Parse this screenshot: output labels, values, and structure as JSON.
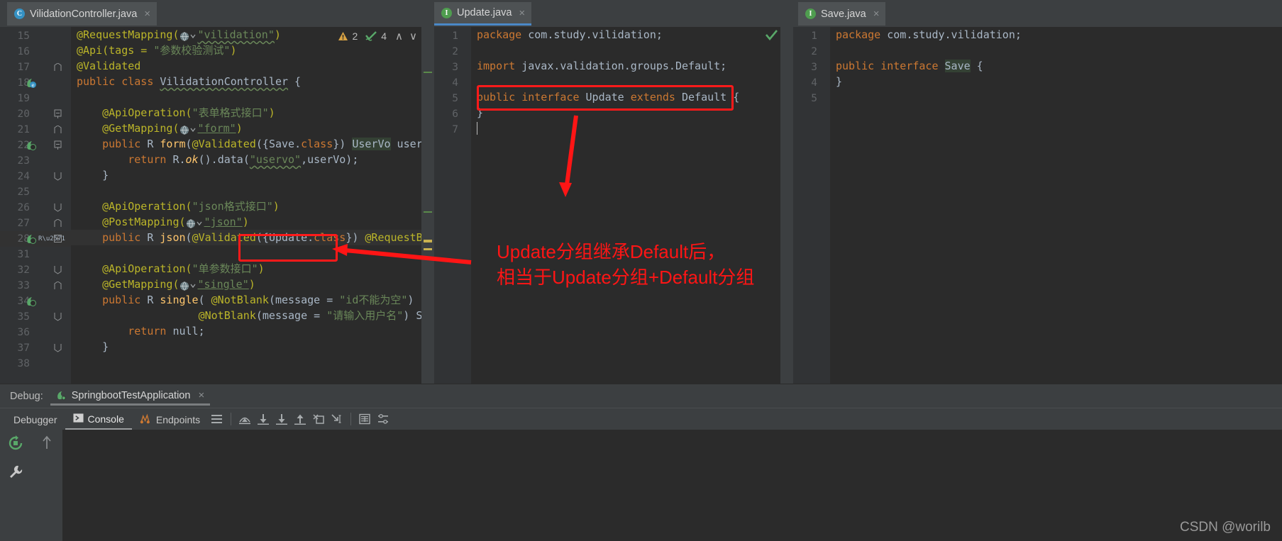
{
  "editors": [
    {
      "tab": {
        "label": "VilidationController.java",
        "icon": "class-icon",
        "close": "×",
        "icon_letter": "C"
      },
      "status": {
        "warnings_icon": "warning-triangle-icon",
        "warnings": "2",
        "checks_icon": "green-check-wave-icon",
        "checks": "4",
        "up": "∧",
        "down": "∨"
      },
      "lines": [
        {
          "n": "15",
          "text": "@RequestMapping(●⌄\"vilidation\")"
        },
        {
          "n": "16",
          "text": "@Api(tags = \"参数校验测试\")"
        },
        {
          "n": "17",
          "text": "@Validated"
        },
        {
          "n": "18",
          "text": "public class VilidationController {"
        },
        {
          "n": "19",
          "text": ""
        },
        {
          "n": "20",
          "text": "    @ApiOperation(\"表单格式接口\")"
        },
        {
          "n": "21",
          "text": "    @GetMapping(●⌄\"form\")"
        },
        {
          "n": "22",
          "text": "    public R form(@Validated({Save.class}) UserVo userVo){"
        },
        {
          "n": "23",
          "text": "        return R.ok().data(\"uservo\",userVo);"
        },
        {
          "n": "24",
          "text": "    }"
        },
        {
          "n": "25",
          "text": ""
        },
        {
          "n": "26",
          "text": "    @ApiOperation(\"json格式接口\")"
        },
        {
          "n": "27",
          "text": "    @PostMapping(●⌄\"json\")"
        },
        {
          "n": "28",
          "text": "    public R json(@Validated({Update.class}) @RequestBody Use"
        },
        {
          "n": "31",
          "text": ""
        },
        {
          "n": "32",
          "text": "    @ApiOperation(\"单参数接口\")"
        },
        {
          "n": "33",
          "text": "    @GetMapping(●⌄\"single\")"
        },
        {
          "n": "34",
          "text": "    public R single( @NotBlank(message = \"id不能为空\")  String"
        },
        {
          "n": "35",
          "text": "                   @NotBlank(message = \"请输入用户名\") String"
        },
        {
          "n": "36",
          "text": "        return null;"
        },
        {
          "n": "37",
          "text": "    }"
        },
        {
          "n": "38",
          "text": ""
        }
      ]
    },
    {
      "tab": {
        "label": "Update.java",
        "icon": "interface-icon",
        "close": "×",
        "icon_letter": "I"
      },
      "status": {
        "ok_icon": "green-check-icon"
      },
      "lines": [
        {
          "n": "1",
          "text": "package com.study.vilidation;"
        },
        {
          "n": "2",
          "text": ""
        },
        {
          "n": "3",
          "text": "import javax.validation.groups.Default;"
        },
        {
          "n": "4",
          "text": ""
        },
        {
          "n": "5",
          "text": "public interface Update extends Default {"
        },
        {
          "n": "6",
          "text": "}"
        },
        {
          "n": "7",
          "text": ""
        }
      ]
    },
    {
      "tab": {
        "label": "Save.java",
        "icon": "interface-icon",
        "close": "×",
        "icon_letter": "I"
      },
      "lines": [
        {
          "n": "1",
          "text": "package com.study.vilidation;"
        },
        {
          "n": "2",
          "text": ""
        },
        {
          "n": "3",
          "text": "public interface Save {"
        },
        {
          "n": "4",
          "text": "}"
        },
        {
          "n": "5",
          "text": ""
        }
      ]
    }
  ],
  "annotation": {
    "line1": "Update分组继承Default后，",
    "line2": "相当于Update分组+Default分组",
    "color": "#ff1515"
  },
  "debug": {
    "label": "Debug:",
    "config_name": "SpringbootTestApplication",
    "config_close": "×",
    "tabs": [
      {
        "label": "Debugger",
        "selected": false,
        "icon": ""
      },
      {
        "label": "Console",
        "selected": true,
        "icon": "console-icon"
      },
      {
        "label": "Endpoints",
        "selected": false,
        "icon": "endpoints-icon"
      }
    ],
    "toolbar_icons": [
      "layout-lines-icon",
      "step-over-icon",
      "step-into-icon",
      "force-step-into-icon",
      "step-out-icon",
      "drop-frame-icon",
      "run-to-cursor-icon",
      "evaluate-expression-icon",
      "settings-lines-icon"
    ],
    "rail_icons": [
      "rerun-icon",
      "wrench-icon"
    ],
    "sub_rail_icons": [
      "scroll-up-icon"
    ]
  },
  "watermark": "CSDN @worilb",
  "colors": {
    "accent_blue": "#4a88c7",
    "annotation_red": "#ff1515",
    "editor_bg": "#2b2b2b",
    "panel_bg": "#3c3f41",
    "gutter_bg": "#313335"
  }
}
